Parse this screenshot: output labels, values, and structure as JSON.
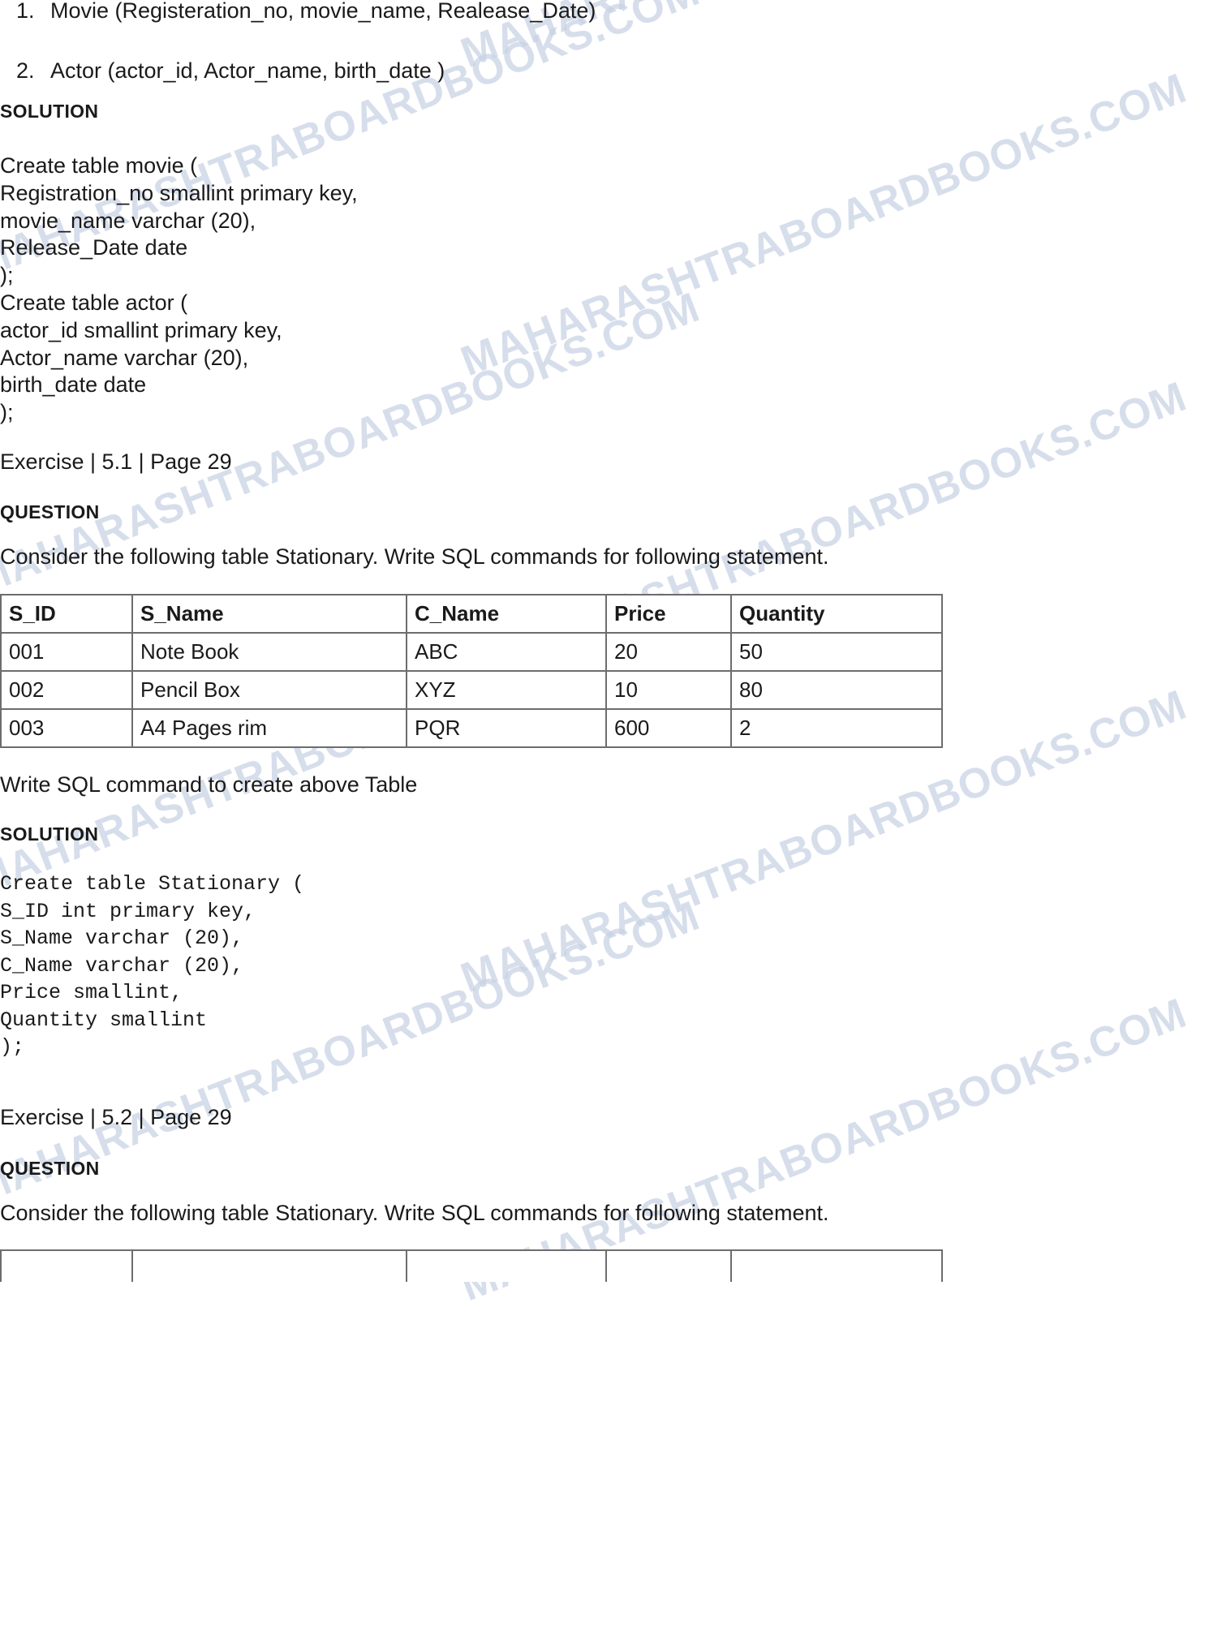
{
  "document": {
    "watermark_text": "MAHARASHTRABOARDBOOKS.COM",
    "watermark_color": "#c8d2e4"
  },
  "relations": {
    "items": [
      {
        "num": "1.",
        "text": "Movie (Registeration_no, movie_name, Realease_Date)"
      },
      {
        "num": "2.",
        "text": "Actor (actor_id, Actor_name, birth_date )"
      }
    ]
  },
  "solution_1": {
    "heading": "SOLUTION",
    "code": "Create table movie (\nRegistration_no smallint primary key,\nmovie_name varchar (20),\nRelease_Date date\n);\nCreate table actor (\nactor_id smallint primary key,\nActor_name varchar (20),\nbirth_date date\n);"
  },
  "exercise_5_1": {
    "exercise_line": "Exercise | 5.1 | Page 29",
    "question_heading": "QUESTION",
    "question_text": "Consider the following table Stationary. Write SQL commands for following statement.",
    "table": {
      "headers": [
        "S_ID",
        "S_Name",
        "C_Name",
        "Price",
        "Quantity"
      ],
      "rows": [
        [
          "001",
          "Note Book",
          "ABC",
          "20",
          "50"
        ],
        [
          "002",
          "Pencil Box",
          "XYZ",
          "10",
          "80"
        ],
        [
          "003",
          "A4 Pages rim",
          "PQR",
          "600",
          "2"
        ]
      ]
    },
    "instruction": "Write SQL command to create above Table",
    "solution_heading": "SOLUTION",
    "solution_code": "Create table Stationary (\nS_ID int primary key,\nS_Name varchar (20),\nC_Name varchar (20),\nPrice smallint,\nQuantity smallint\n);"
  },
  "exercise_5_2": {
    "exercise_line": "Exercise | 5.2 | Page 29",
    "question_heading": "QUESTION",
    "question_text": "Consider the following table Stationary. Write SQL commands for following statement.",
    "table": {
      "headers": [
        "",
        "",
        "",
        "",
        ""
      ],
      "rows": [
        [
          "",
          "",
          "",
          "",
          ""
        ]
      ]
    }
  }
}
